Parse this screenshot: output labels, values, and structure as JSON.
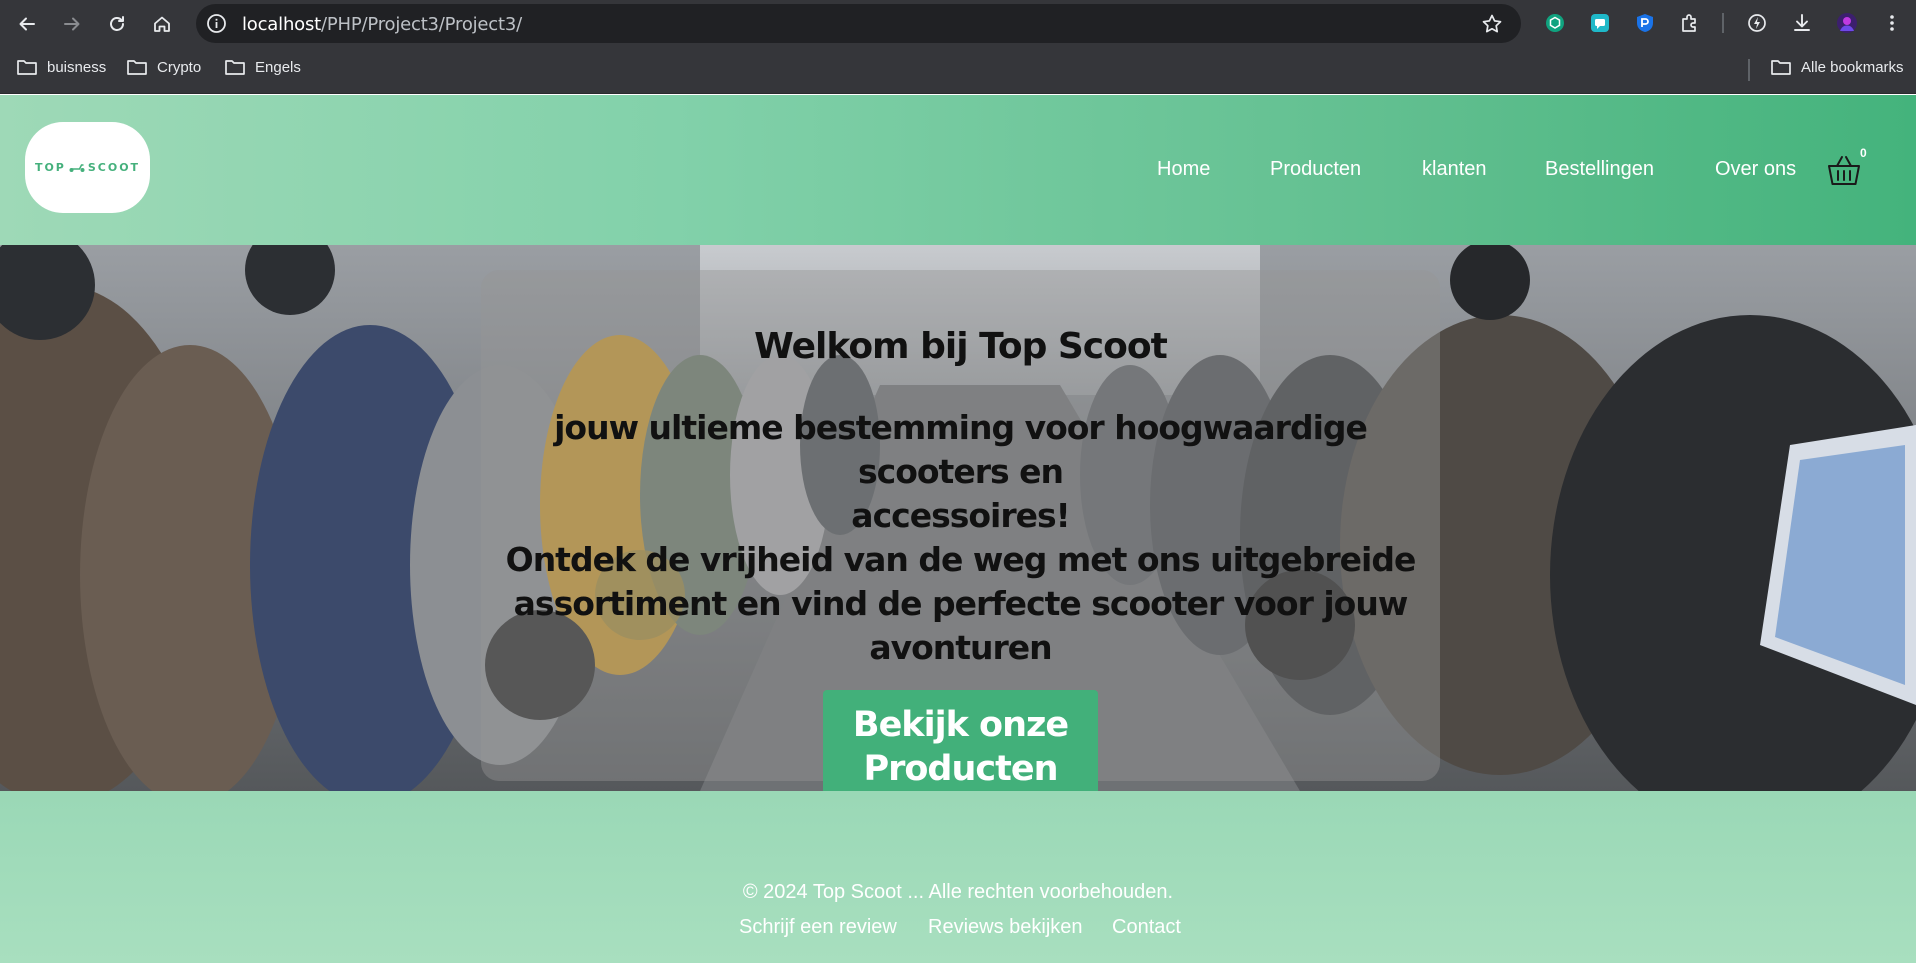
{
  "browser": {
    "url_host": "localhost",
    "url_path": "/PHP/Project3/Project3/",
    "bookmarks": [
      {
        "label": "buisness"
      },
      {
        "label": "Crypto"
      },
      {
        "label": "Engels"
      }
    ],
    "all_bookmarks_label": "Alle bookmarks"
  },
  "site": {
    "logo_text_left": "TOP",
    "logo_text_right": "SCOOT",
    "nav": [
      {
        "label": "Home"
      },
      {
        "label": "Producten"
      },
      {
        "label": "klanten"
      },
      {
        "label": "Bestellingen"
      },
      {
        "label": "Over ons"
      }
    ],
    "cart_count": "0"
  },
  "hero": {
    "title": "Welkom bij Top Scoot",
    "lines": [
      "jouw ultieme bestemming voor hoogwaardige scooters en",
      "accessoires!",
      "Ontdek de vrijheid van de weg met ons uitgebreide",
      "assortiment en vind de perfecte scooter voor jouw",
      "avonturen"
    ],
    "cta_line1": "Bekijk onze",
    "cta_line2": "Producten"
  },
  "footer": {
    "copyright": "© 2024 Top Scoot ... Alle rechten voorbehouden.",
    "links": [
      {
        "label": "Schrijf een review"
      },
      {
        "label": "Reviews bekijken"
      },
      {
        "label": "Contact"
      }
    ]
  },
  "colors": {
    "brand_green": "#42b07a",
    "header_light": "#9ed9b7",
    "header_dark": "#44b37c",
    "chrome_bg": "#35363a"
  }
}
